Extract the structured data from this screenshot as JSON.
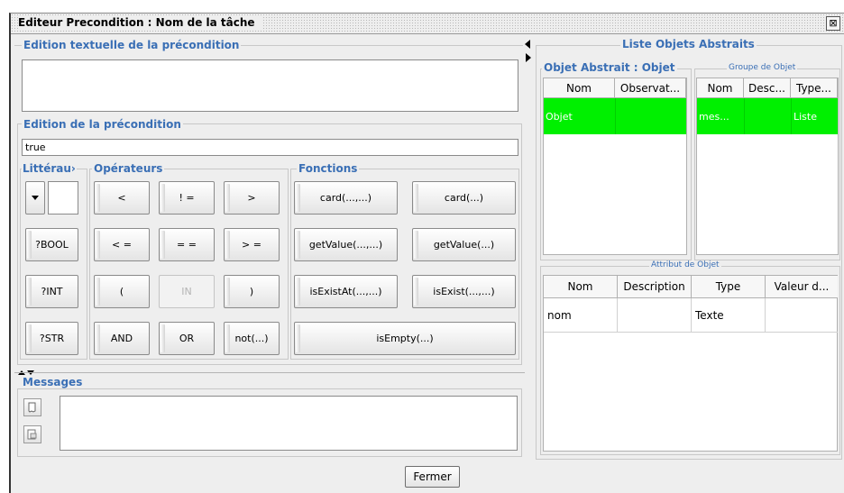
{
  "window": {
    "title": "Editeur Precondition : Nom de la tâche"
  },
  "left": {
    "textual_group": "Edition textuelle de la précondition",
    "textual_value": "",
    "edit_group": "Edition de la précondition",
    "edit_value": "true",
    "litteraux_group": "Littérau›",
    "operateurs_group": "Opérateurs",
    "fonctions_group": "Fonctions",
    "literals": {
      "bool": "?BOOL",
      "int": "?INT",
      "str": "?STR"
    },
    "operators": {
      "lt": "<",
      "ne": "! =",
      "gt": ">",
      "le": "< =",
      "eq": "= =",
      "ge": "> =",
      "lparen": "(",
      "in": "IN",
      "rparen": ")",
      "and": "AND",
      "or": "OR",
      "not": "not(...)"
    },
    "functions": {
      "card2": "card(...,...)",
      "card1": "card(...)",
      "getvalue2": "getValue(...,...)",
      "getvalue1": "getValue(...)",
      "isexistat": "isExistAt(...,...)",
      "isexist": "isExist(...,...)",
      "isempty": "isEmpty(...)"
    },
    "messages_group": "Messages"
  },
  "right": {
    "liste_group": "Liste Objets Abstraits",
    "objet_group": "Objet Abstrait : Objet",
    "objet_table": {
      "columns": [
        "Nom",
        "Observat..."
      ],
      "rows": [
        [
          "Objet",
          ""
        ]
      ]
    },
    "groupe_group": "Groupe de Objet",
    "groupe_table": {
      "columns": [
        "Nom",
        "Desc...",
        "Type..."
      ],
      "rows": [
        [
          "mes...",
          "",
          "Liste"
        ]
      ]
    },
    "attribut_group": "Attribut de Objet",
    "attribut_table": {
      "columns": [
        "Nom",
        "Description",
        "Type",
        "Valeur d..."
      ],
      "rows": [
        [
          "nom",
          "",
          "Texte",
          ""
        ]
      ]
    }
  },
  "footer": {
    "close_label": "Fermer"
  },
  "colors": {
    "accent": "#3a6fb5",
    "selection": "#00f000"
  },
  "icons": [
    "close-icon",
    "dropdown-arrow-icon",
    "collapse-left-icon",
    "expand-right-icon",
    "split-up-down-icon",
    "note-icon",
    "document-icon"
  ]
}
